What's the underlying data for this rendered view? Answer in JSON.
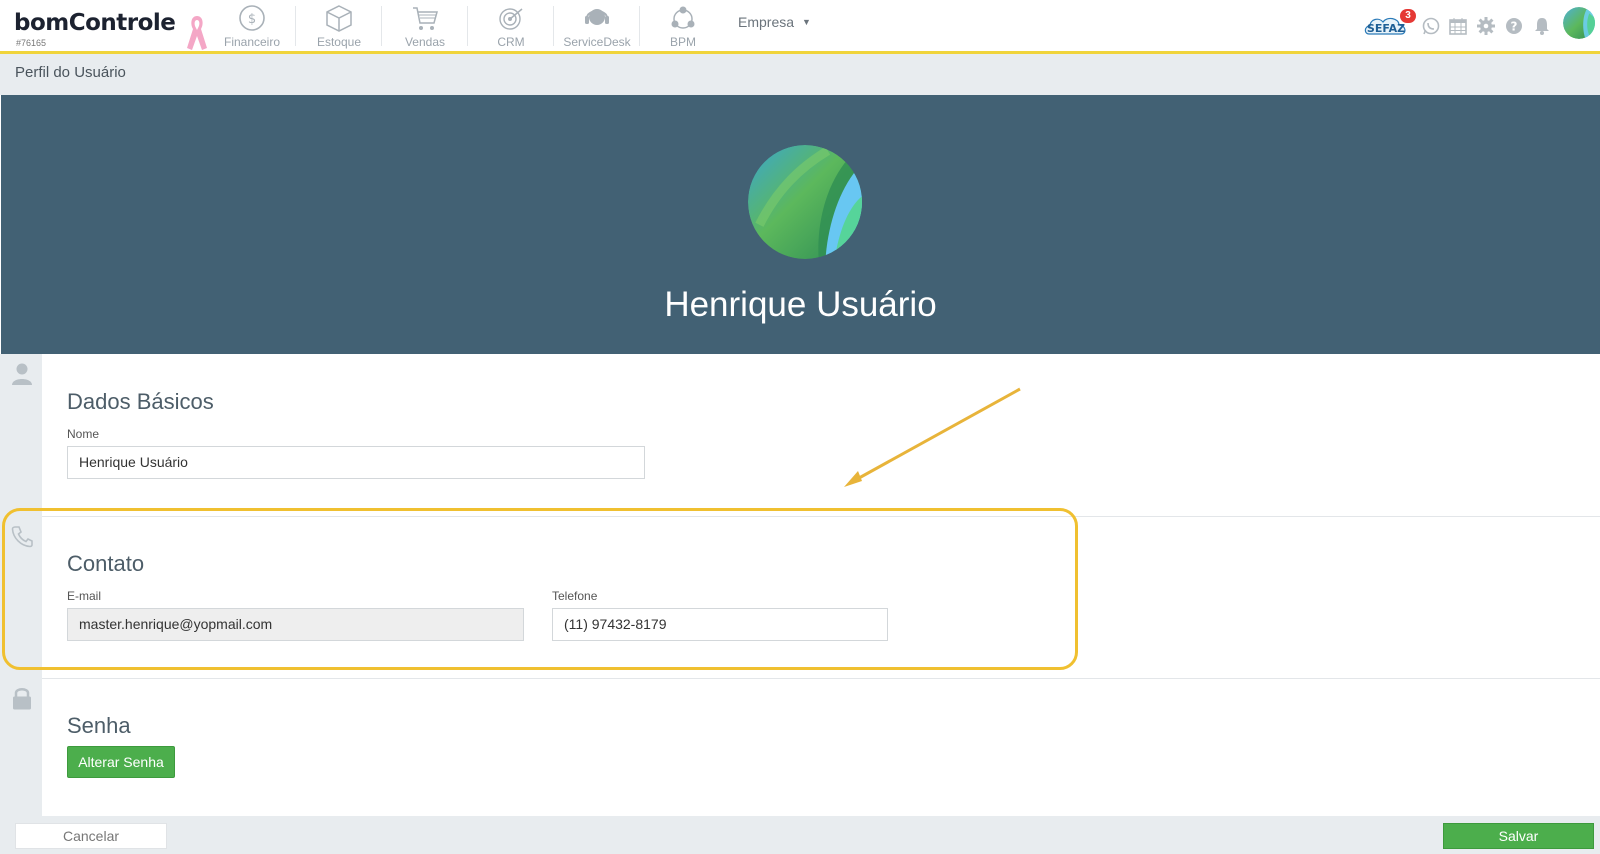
{
  "app": {
    "logo_text": "bomControle",
    "account_id": "#76165"
  },
  "nav": {
    "modules": [
      {
        "label": "Financeiro",
        "icon": "dollar-coin-icon"
      },
      {
        "label": "Estoque",
        "icon": "box-icon"
      },
      {
        "label": "Vendas",
        "icon": "cart-icon"
      },
      {
        "label": "CRM",
        "icon": "target-icon"
      },
      {
        "label": "ServiceDesk",
        "icon": "headset-icon"
      },
      {
        "label": "BPM",
        "icon": "workflow-icon"
      }
    ],
    "company_selector": "Empresa",
    "sefaz_label": "SEFAZ",
    "sefaz_badge": "3",
    "right_icons": [
      "whatsapp-icon",
      "calendar-icon",
      "gear-icon",
      "help-icon",
      "bell-icon",
      "user-avatar"
    ]
  },
  "page": {
    "title": "Perfil do Usuário"
  },
  "profile": {
    "display_name": "Henrique Usuário"
  },
  "basic": {
    "title": "Dados Básicos",
    "name_label": "Nome",
    "name_value": "Henrique Usuário"
  },
  "contact": {
    "title": "Contato",
    "email_label": "E-mail",
    "email_value": "master.henrique@yopmail.com",
    "phone_label": "Telefone",
    "phone_value": "(11) 97432-8179"
  },
  "password": {
    "title": "Senha",
    "change_button": "Alterar Senha"
  },
  "footer": {
    "cancel_label": "Cancelar",
    "save_label": "Salvar"
  },
  "colors": {
    "accent_yellow": "#f0d43a",
    "hero_bg": "#426174",
    "primary_green": "#4cae4c",
    "annotation": "#f0c030"
  }
}
